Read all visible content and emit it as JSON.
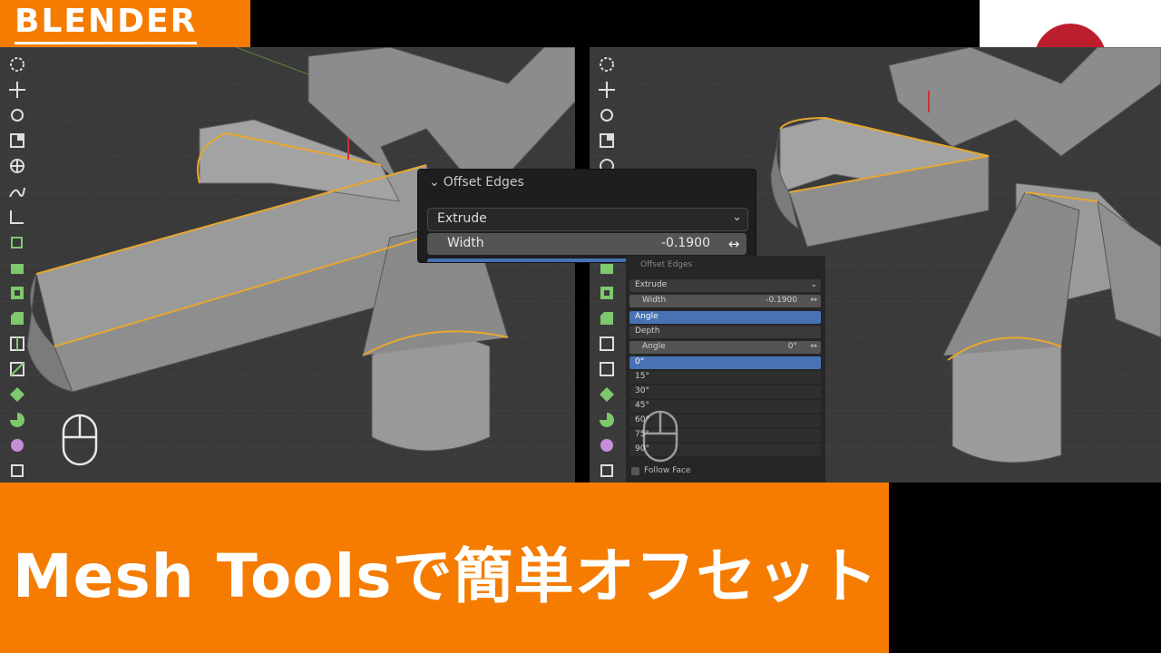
{
  "brand": {
    "label": "BLENDER"
  },
  "banner": {
    "title": "Mesh Toolsで簡単オフセット"
  },
  "flag": {
    "name": "japan-flag",
    "sun_color": "#bc1e2d"
  },
  "colors": {
    "accent": "#f57c00",
    "blender_blue": "#4772b3",
    "mesh_outline": "#e7a731"
  },
  "toolbar": {
    "icons": [
      "cursor-icon",
      "move-icon",
      "rotate-icon",
      "scale-icon",
      "transform-icon",
      "annotate-icon",
      "measure-icon",
      "add-cube-icon",
      "extrude-icon",
      "inset-icon",
      "bevel-icon",
      "loop-cut-icon",
      "knife-icon",
      "poly-build-icon",
      "spin-icon",
      "smooth-icon",
      "shrink-fatten-icon"
    ]
  },
  "operator_panel": {
    "title": "Offset Edges",
    "mode_value": "Extrude",
    "width_label": "Width",
    "width_value": "-0.1900"
  },
  "operator_panel_small": {
    "title": "Offset Edges",
    "mode_value": "Extrude",
    "width_label": "Width",
    "width_value": "-0.1900",
    "mode_options": [
      "Angle",
      "Depth"
    ],
    "angle_label": "Angle",
    "angle_value": "0°",
    "angle_presets": [
      "0°",
      "15°",
      "30°",
      "45°",
      "60°",
      "75°",
      "90°"
    ],
    "follow_face_label": "Follow Face"
  }
}
